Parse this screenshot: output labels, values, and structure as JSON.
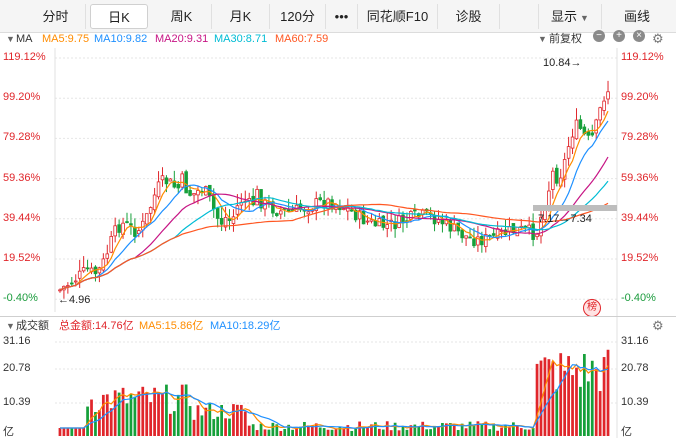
{
  "toolbar": {
    "tabs": [
      {
        "label": "分时",
        "active": false
      },
      {
        "label": "日K",
        "active": true
      },
      {
        "label": "周K",
        "active": false
      },
      {
        "label": "月K",
        "active": false
      },
      {
        "label": "120分",
        "active": false
      },
      {
        "label": "•••",
        "active": false
      },
      {
        "label": "同花顺F10",
        "active": false
      },
      {
        "label": "诊股",
        "active": false
      }
    ],
    "display_label": "显示",
    "draw_label": "画线",
    "icons": [
      "chevron-down-icon"
    ]
  },
  "price_panel": {
    "indicator_name": "MA",
    "ma": [
      {
        "label": "MA5:9.75",
        "color": "#ff8c00"
      },
      {
        "label": "MA10:9.82",
        "color": "#1e90ff"
      },
      {
        "label": "MA20:9.31",
        "color": "#c71585"
      },
      {
        "label": "MA30:8.71",
        "color": "#00bcd4"
      },
      {
        "label": "MA60:7.59",
        "color": "#ff5722"
      }
    ],
    "adjust_label": "前复权",
    "y_labels": [
      "119.12%",
      "99.20%",
      "79.28%",
      "59.36%",
      "39.44%",
      "19.52%",
      "-0.40%"
    ],
    "y_colors": [
      "#e0262b",
      "#e0262b",
      "#e0262b",
      "#e0262b",
      "#e0262b",
      "#e0262b",
      "#1a9b3c"
    ],
    "annotations": {
      "high": "10.84→",
      "low": "←4.96",
      "range": "7.17→7.34"
    },
    "badge": "榜"
  },
  "volume_panel": {
    "indicator_name": "成交额",
    "items": [
      {
        "label": "总金额:14.76亿",
        "color": "#e0262b"
      },
      {
        "label": "MA5:15.86亿",
        "color": "#ff8c00"
      },
      {
        "label": "MA10:18.29亿",
        "color": "#1e90ff"
      }
    ],
    "y_labels": [
      "31.16",
      "20.78",
      "10.39",
      "亿"
    ]
  },
  "colors": {
    "up": "#e0262b",
    "down": "#16a03a",
    "grid": "#e6e6e6"
  }
}
